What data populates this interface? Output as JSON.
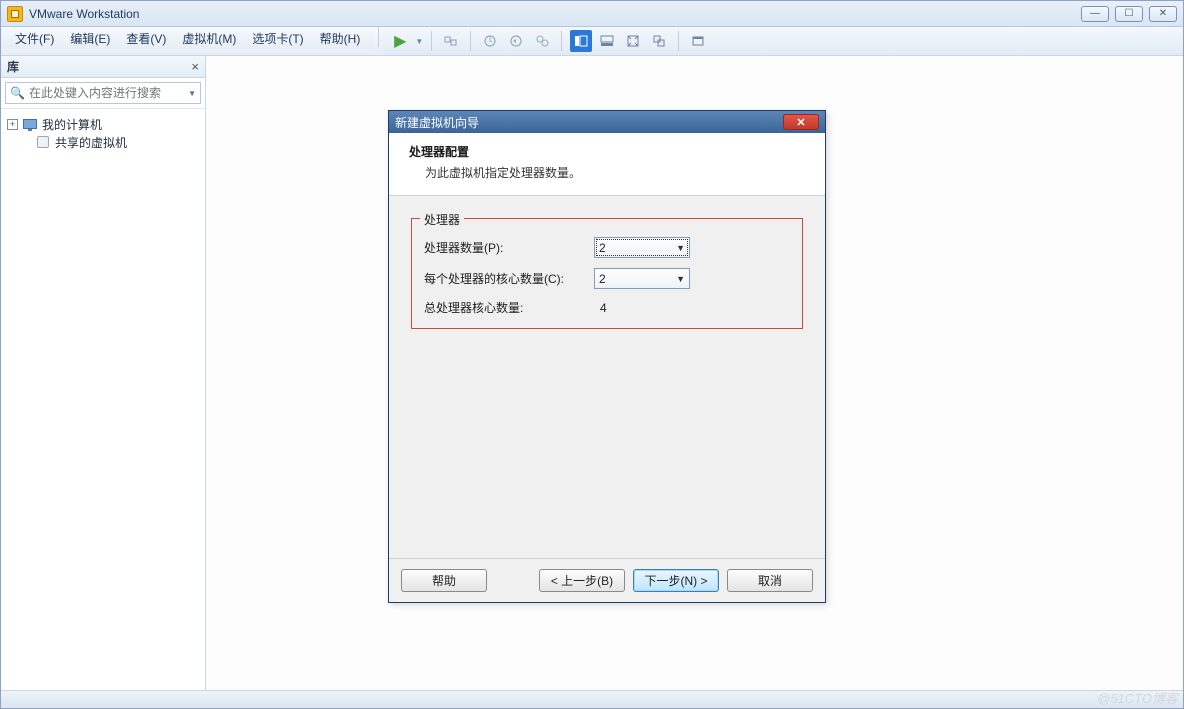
{
  "window": {
    "title": "VMware Workstation"
  },
  "menu": {
    "file": "文件(F)",
    "edit": "编辑(E)",
    "view": "查看(V)",
    "vm": "虚拟机(M)",
    "tabs": "选项卡(T)",
    "help": "帮助(H)"
  },
  "sidebar": {
    "title": "库",
    "search_placeholder": "在此处键入内容进行搜索",
    "node_my_computer": "我的计算机",
    "node_shared_vm": "共享的虚拟机"
  },
  "dialog": {
    "title": "新建虚拟机向导",
    "header_title": "处理器配置",
    "header_subtitle": "为此虚拟机指定处理器数量。",
    "group_label": "处理器",
    "row_proc_count_label": "处理器数量(P):",
    "row_proc_count_value": "2",
    "row_cores_label": "每个处理器的核心数量(C):",
    "row_cores_value": "2",
    "row_total_label": "总处理器核心数量:",
    "row_total_value": "4",
    "btn_help": "帮助",
    "btn_back": "< 上一步(B)",
    "btn_next": "下一步(N) >",
    "btn_cancel": "取消"
  },
  "watermark": "@51CTO博客"
}
